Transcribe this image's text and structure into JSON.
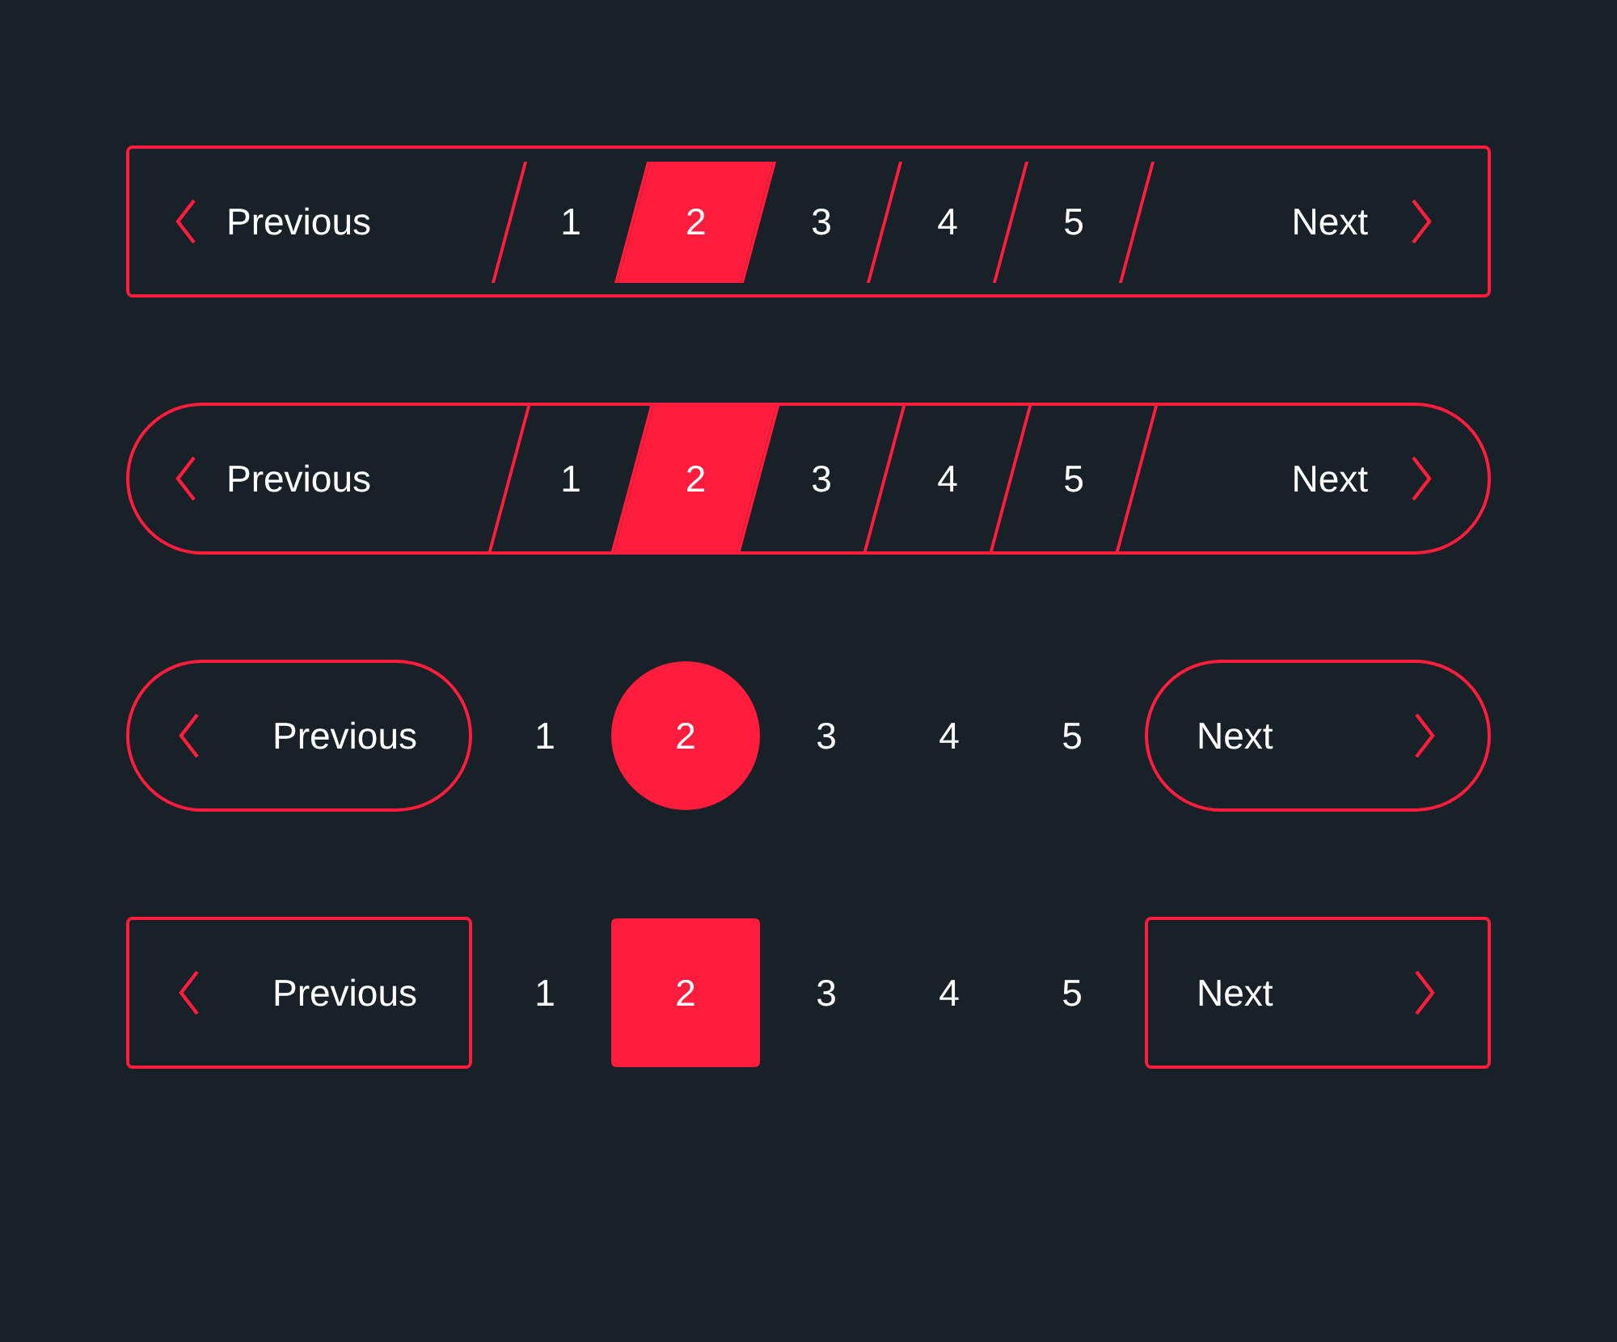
{
  "paginations": [
    {
      "kind": "slanted-box",
      "previous": "Previous",
      "next": "Next",
      "pages": [
        {
          "label": "1",
          "selected": false
        },
        {
          "label": "2",
          "selected": true
        },
        {
          "label": "3",
          "selected": false
        },
        {
          "label": "4",
          "selected": false
        },
        {
          "label": "5",
          "selected": false
        }
      ]
    },
    {
      "kind": "slanted-pill",
      "previous": "Previous",
      "next": "Next",
      "pages": [
        {
          "label": "1",
          "selected": false
        },
        {
          "label": "2",
          "selected": true
        },
        {
          "label": "3",
          "selected": false
        },
        {
          "label": "4",
          "selected": false
        },
        {
          "label": "5",
          "selected": false
        }
      ]
    },
    {
      "kind": "pill",
      "previous": "Previous",
      "next": "Next",
      "pages": [
        {
          "label": "1",
          "selected": false
        },
        {
          "label": "2",
          "selected": true
        },
        {
          "label": "3",
          "selected": false
        },
        {
          "label": "4",
          "selected": false
        },
        {
          "label": "5",
          "selected": false
        }
      ]
    },
    {
      "kind": "box",
      "previous": "Previous",
      "next": "Next",
      "pages": [
        {
          "label": "1",
          "selected": false
        },
        {
          "label": "2",
          "selected": true
        },
        {
          "label": "3",
          "selected": false
        },
        {
          "label": "4",
          "selected": false
        },
        {
          "label": "5",
          "selected": false
        }
      ]
    }
  ]
}
